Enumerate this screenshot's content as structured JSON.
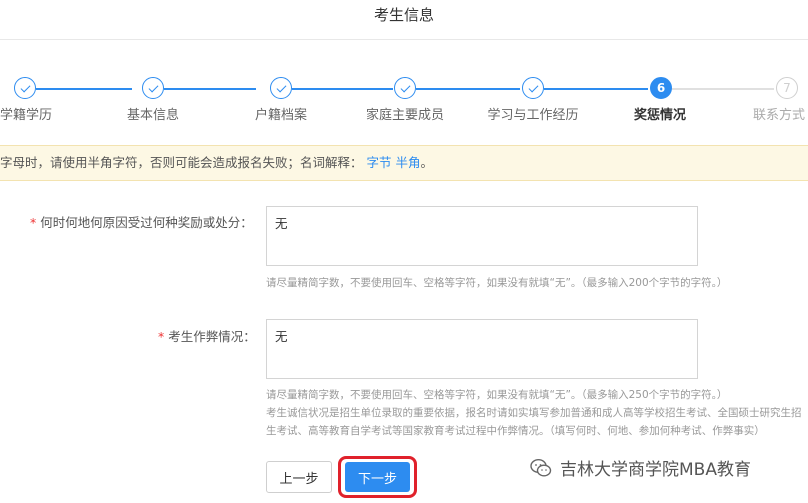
{
  "page": {
    "title": "考生信息"
  },
  "steps": [
    {
      "label": "学籍学历",
      "state": "done"
    },
    {
      "label": "基本信息",
      "state": "done"
    },
    {
      "label": "户籍档案",
      "state": "done"
    },
    {
      "label": "家庭主要成员",
      "state": "done"
    },
    {
      "label": "学习与工作经历",
      "state": "done"
    },
    {
      "label": "奖惩情况",
      "state": "active",
      "number": "6"
    },
    {
      "label": "联系方式",
      "state": "pending",
      "number": "7"
    }
  ],
  "notice": {
    "text": "字母时，请使用半角字符，否则可能会造成报名失败；名词解释：",
    "link1": "字节",
    "link2": "半角",
    "end": "。"
  },
  "fields": {
    "rewards": {
      "label": "何时何地何原因受过何种奖励或处分：",
      "value": "无",
      "hint": "请尽量精简字数，不要使用回车、空格等字符，如果没有就填“无”。（最多输入200个字节的字符。）"
    },
    "cheating": {
      "label": "考生作弊情况：",
      "value": "无",
      "hint1": "请尽量精简字数，不要使用回车、空格等字符，如果没有就填“无”。（最多输入250个字节的字符。）",
      "hint2": "考生诚信状况是招生单位录取的重要依据，报名时请如实填写参加普通和成人高等学校招生考试、全国硕士研究生招",
      "hint3": "生考试、高等教育自学考试等国家教育考试过程中作弊情况。（填写何时、何地、参加何种考试、作弊事实）"
    }
  },
  "buttons": {
    "prev": "上一步",
    "next": "下一步"
  },
  "watermark": {
    "text": "吉林大学商学院MBA教育"
  },
  "colors": {
    "accent": "#2d8cf0",
    "highlight": "#e0212b",
    "notice_bg": "#fdf8e4",
    "required": "#e33"
  }
}
